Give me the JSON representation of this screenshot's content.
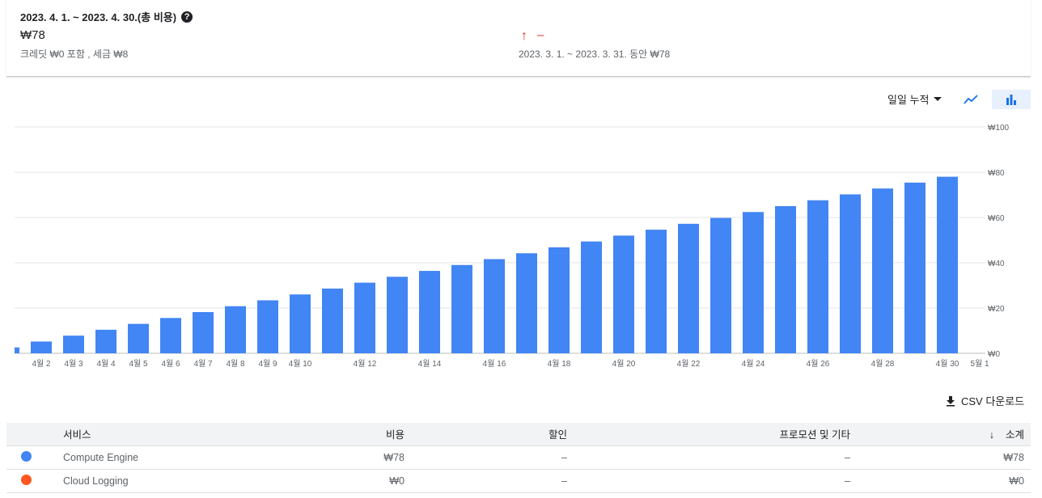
{
  "summary": {
    "period": "2023. 4. 1. ~ 2023. 4. 30.(총 비용)",
    "total": "₩78",
    "credit": "크레딧 ₩0 포함 , 세금 ₩8",
    "compare_value": "–",
    "compare_text": "2023. 3. 1. ~ 2023. 3. 31. 동안 ₩78"
  },
  "toolbar": {
    "view_label": "일일 누적",
    "line_icon": "line-chart-icon",
    "bar_icon": "bar-chart-icon",
    "csv_label": "CSV 다운로드"
  },
  "chart_data": {
    "type": "bar",
    "title": "",
    "xlabel": "",
    "ylabel": "",
    "ylim": [
      0,
      100
    ],
    "y_ticks": [
      "₩0",
      "₩20",
      "₩40",
      "₩60",
      "₩80",
      "₩100"
    ],
    "categories": [
      "4월 1",
      "4월 2",
      "4월 3",
      "4월 4",
      "4월 5",
      "4월 6",
      "4월 7",
      "4월 8",
      "4월 9",
      "4월 10",
      "4월 11",
      "4월 12",
      "4월 13",
      "4월 14",
      "4월 15",
      "4월 16",
      "4월 17",
      "4월 18",
      "4월 19",
      "4월 20",
      "4월 21",
      "4월 22",
      "4월 23",
      "4월 24",
      "4월 25",
      "4월 26",
      "4월 27",
      "4월 28",
      "4월 29",
      "4월 30"
    ],
    "x_tick_labels": [
      "4월 2",
      "4월 3",
      "4월 4",
      "4월 5",
      "4월 6",
      "4월 7",
      "4월 8",
      "4월 9",
      "4월 10",
      "4월 12",
      "4월 14",
      "4월 16",
      "4월 18",
      "4월 20",
      "4월 22",
      "4월 24",
      "4월 26",
      "4월 28",
      "4월 30",
      "5월 1"
    ],
    "values": [
      2.6,
      5.2,
      7.8,
      10.4,
      13.0,
      15.6,
      18.2,
      20.8,
      23.4,
      26.0,
      28.6,
      31.2,
      33.8,
      36.4,
      39.0,
      41.6,
      44.2,
      46.8,
      49.4,
      52.0,
      54.6,
      57.2,
      59.8,
      62.4,
      65.0,
      67.6,
      70.2,
      72.8,
      75.4,
      78.0
    ],
    "bar_color": "#4285f4",
    "grid": true
  },
  "table": {
    "headers": {
      "service": "서비스",
      "cost": "비용",
      "discount": "할인",
      "promo": "프로모션 및 기타",
      "subtotal": "소계"
    },
    "rows": [
      {
        "color": "#4285f4",
        "service": "Compute Engine",
        "cost": "₩78",
        "discount": "–",
        "promo": "–",
        "subtotal": "₩78"
      },
      {
        "color": "#ff5722",
        "service": "Cloud Logging",
        "cost": "₩0",
        "discount": "–",
        "promo": "–",
        "subtotal": "₩0"
      }
    ]
  }
}
